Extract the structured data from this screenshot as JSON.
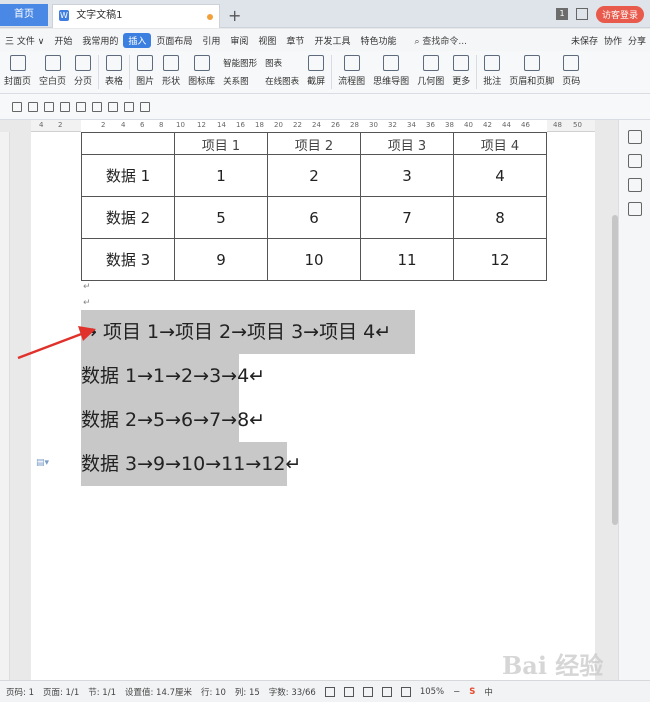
{
  "tabs": {
    "home": "首页",
    "doc": "文字文稿1"
  },
  "window": {
    "badge": "1",
    "login": "访客登录"
  },
  "menu": {
    "items": [
      "三 文件 ∨",
      "开始",
      "我常用的",
      "插入",
      "页面布局",
      "引用",
      "审阅",
      "视图",
      "章节",
      "开发工具",
      "特色功能"
    ],
    "active_index": 3,
    "search": "查找命令...",
    "unsaved": "未保存",
    "collab": "协作",
    "share": "分享"
  },
  "ribbon": {
    "cover": "封面页",
    "blank": "空白页",
    "pagebreak": "分页",
    "table": "表格",
    "picture": "图片",
    "shape": "形状",
    "iconlib": "图标库",
    "smartart": "智能图形",
    "chart": "图表",
    "relation": "关系图",
    "online_chart": "在线图表",
    "screenshot": "截屏",
    "flowchart": "流程图",
    "mindmap": "思维导图",
    "geometry": "几何图",
    "more": "更多",
    "comment": "批注",
    "header_footer": "页眉和页脚",
    "page_num": "页码"
  },
  "ruler_ticks": [
    "4",
    "2",
    "2",
    "4",
    "6",
    "8",
    "10",
    "12",
    "14",
    "16",
    "18",
    "20",
    "22",
    "24",
    "26",
    "28",
    "30",
    "32",
    "34",
    "36",
    "38",
    "40",
    "42",
    "44",
    "46",
    "48",
    "50"
  ],
  "table": {
    "cut_row": [
      "",
      "项目 1",
      "项目 2",
      "项目 3",
      "项目 4"
    ],
    "rows": [
      [
        "数据 1",
        "1",
        "2",
        "3",
        "4"
      ],
      [
        "数据 2",
        "5",
        "6",
        "7",
        "8"
      ],
      [
        "数据 3",
        "9",
        "10",
        "11",
        "12"
      ]
    ]
  },
  "text_lines": [
    "→ 项目 1→项目 2→项目 3→项目 4↵",
    "数据 1→1→2→3→4↵",
    "数据 2→5→6→7→8↵",
    "数据 3→9→10→11→12↵"
  ],
  "status": {
    "page": "页码: 1",
    "pages": "页面: 1/1",
    "section": "节: 1/1",
    "setting": "设置值: 14.7厘米",
    "row": "行: 10",
    "col": "列: 15",
    "words": "字数: 33/66",
    "zoom": "105%",
    "ime": "中"
  },
  "watermark": "Bai 经验",
  "colors": {
    "accent": "#3b7fe0",
    "selection": "#c8c8c8",
    "arrow": "#e0322b",
    "login": "#e85a4b"
  }
}
